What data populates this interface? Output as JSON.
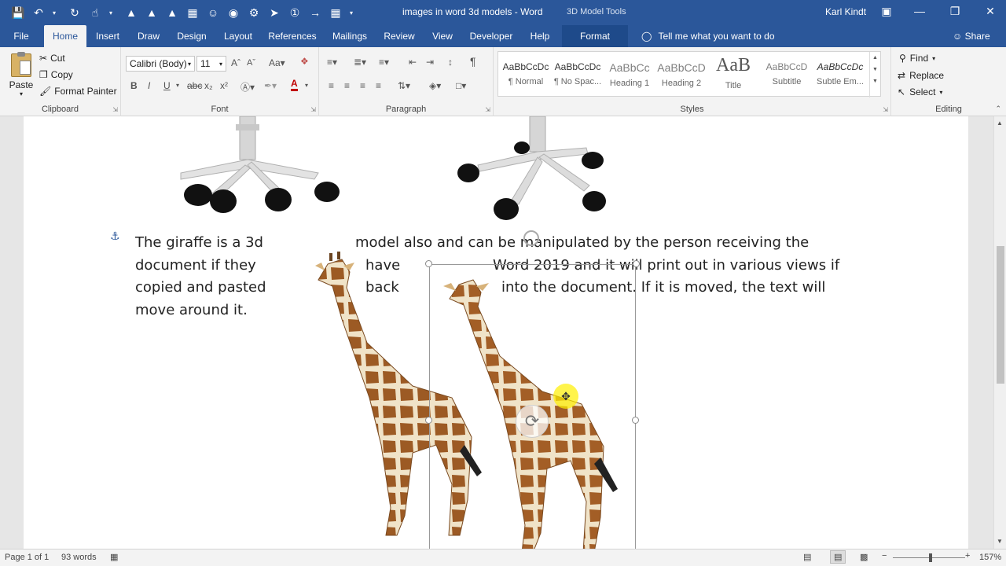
{
  "titlebar": {
    "title": "images in word 3d models  -  Word",
    "context_tools": "3D Model Tools",
    "user": "Karl Kindt"
  },
  "tabs": [
    "File",
    "Home",
    "Insert",
    "Draw",
    "Design",
    "Layout",
    "References",
    "Mailings",
    "Review",
    "View",
    "Developer",
    "Help",
    "Format"
  ],
  "tell_me": "Tell me what you want to do",
  "share": "Share",
  "clipboard": {
    "paste": "Paste",
    "cut": "Cut",
    "copy": "Copy",
    "format_painter": "Format Painter",
    "label": "Clipboard"
  },
  "font": {
    "name": "Calibri (Body)",
    "size": "11",
    "label": "Font"
  },
  "paragraph": {
    "label": "Paragraph"
  },
  "styles": {
    "label": "Styles",
    "items": [
      {
        "sample": "AaBbCcDc",
        "name": "¶ Normal"
      },
      {
        "sample": "AaBbCcDc",
        "name": "¶ No Spac..."
      },
      {
        "sample": "AaBbCc",
        "name": "Heading 1"
      },
      {
        "sample": "AaBbCcD",
        "name": "Heading 2"
      },
      {
        "sample": "AaB",
        "name": "Title"
      },
      {
        "sample": "AaBbCcD",
        "name": "Subtitle"
      },
      {
        "sample": "AaBbCcDc",
        "name": "Subtle Em..."
      }
    ]
  },
  "editing": {
    "find": "Find",
    "replace": "Replace",
    "select": "Select",
    "label": "Editing"
  },
  "document": {
    "lines_left": [
      "The giraffe is a 3d",
      "document if they",
      "copied and pasted",
      "move around it."
    ],
    "line1_right": "model also and can be manipulated by the person receiving the",
    "line2_mid": "have",
    "line2_right": "Word 2019 and it will print out in various views if",
    "line3_mid": "back",
    "line3_right": "into the document.    If it is moved, the text will"
  },
  "status": {
    "page": "Page 1 of 1",
    "words": "93 words",
    "zoom": "157%"
  }
}
